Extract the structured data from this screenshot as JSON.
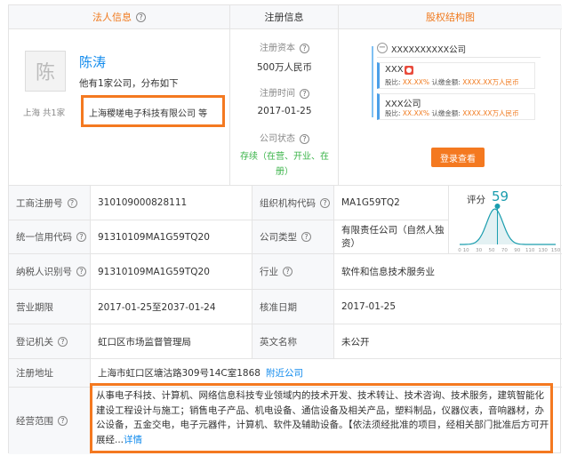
{
  "header": {
    "legal_rep_title": "法人信息",
    "reg_info_title": "注册信息",
    "equity_title": "股权结构图"
  },
  "legal": {
    "avatar_char": "陈",
    "name": "陈涛",
    "desc": "他有1家公司，分布如下",
    "location": "上海  共1家",
    "company": "上海稷嗟电子科技有限公司 等"
  },
  "registration": {
    "capital_label": "注册资本",
    "capital_value": "500万人民币",
    "time_label": "注册时间",
    "time_value": "2017-01-25",
    "status_label": "公司状态",
    "status_value": "存续（在营、开业、在册）"
  },
  "equity": {
    "root": "XXXXXXXXXX公司",
    "card1_name": "XXX",
    "card1_ratio_label": "股比:",
    "card1_ratio": "XX.XX%",
    "card1_amount_label": "认缴金额:",
    "card1_amount": "XXXX.XX万人民币",
    "card2_name": "XXX公司",
    "card2_ratio_label": "股比:",
    "card2_ratio": "XX.XX%",
    "card2_amount_label": "认缴金额:",
    "card2_amount": "XXXX.XX万人民币",
    "login_button": "登录查看"
  },
  "details": {
    "biz_reg_no_label": "工商注册号",
    "biz_reg_no": "310109000828111",
    "org_code_label": "组织机构代码",
    "org_code": "MA1G59TQ2",
    "credit_code_label": "统一信用代码",
    "credit_code": "91310109MA1G59TQ20",
    "company_type_label": "公司类型",
    "company_type": "有限责任公司（自然人独资）",
    "taxpayer_label": "纳税人识别号",
    "taxpayer": "91310109MA1G59TQ20",
    "industry_label": "行业",
    "industry": "软件和信息技术服务业",
    "term_label": "营业期限",
    "term": "2017-01-25至2037-01-24",
    "approval_label": "核准日期",
    "approval": "2017-01-25",
    "authority_label": "登记机关",
    "authority": "虹口区市场监督管理局",
    "english_label": "英文名称",
    "english": "未公开",
    "address_label": "注册地址",
    "address": "上海市虹口区塘沽路309号14C室1868",
    "nearby_link": "附近公司",
    "scope_label": "经营范围",
    "scope": "从事电子科技、计算机、网络信息科技专业领域内的技术开发、技术转让、技术咨询、技术服务，建筑智能化建设工程设计与施工；销售电子产品、机电设备、通信设备及相关产品，塑料制品，仪器仪表，音响器材，办公设备，五金交电，电子元器件，计算机、软件及辅助设备。【依法须经批准的项目，经相关部门批准后方可开展经...",
    "scope_more": "详情"
  },
  "score": {
    "label": "评分",
    "value": "59",
    "axis_ticks": [
      "0",
      "10",
      "30",
      "50",
      "70",
      "90",
      "110",
      "130",
      "150"
    ],
    "color": "#1a9dae"
  }
}
